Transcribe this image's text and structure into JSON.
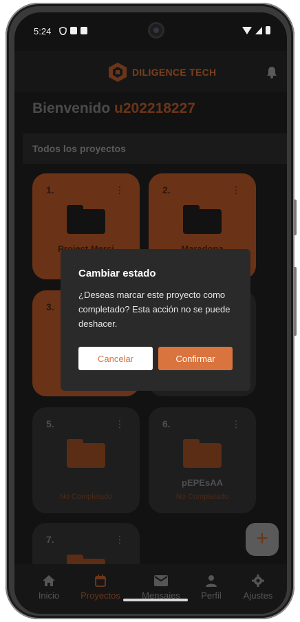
{
  "status_bar": {
    "time": "5:24"
  },
  "header": {
    "brand": "DILIGENCE TECH",
    "accent": "#d9743e"
  },
  "welcome": {
    "greeting": "Bienvenido",
    "username": "u202218227"
  },
  "section": {
    "title": "Todos los proyectos"
  },
  "projects": [
    {
      "num": "1.",
      "name": "Project Merci",
      "status": "",
      "color": "orange"
    },
    {
      "num": "2.",
      "name": "Maradona",
      "status": "",
      "color": "orange"
    },
    {
      "num": "3.",
      "name": "",
      "status": "",
      "color": "orange"
    },
    {
      "num": "",
      "name": "",
      "status": "",
      "color": "dark"
    },
    {
      "num": "5.",
      "name": "",
      "status": "No Completado",
      "color": "dark"
    },
    {
      "num": "6.",
      "name": "pEPEsAA",
      "status": "No Completado",
      "color": "dark"
    },
    {
      "num": "7.",
      "name": "",
      "status": "",
      "color": "dark"
    }
  ],
  "fab": {
    "label": "+"
  },
  "nav": [
    {
      "label": "Inicio",
      "icon": "home-icon"
    },
    {
      "label": "Proyectos",
      "icon": "calendar-icon",
      "active": true
    },
    {
      "label": "Mensajes",
      "icon": "mail-icon"
    },
    {
      "label": "Perfil",
      "icon": "person-icon"
    },
    {
      "label": "Ajustes",
      "icon": "gear-icon"
    }
  ],
  "dialog": {
    "title": "Cambiar estado",
    "body": "¿Deseas marcar este proyecto como completado? Esta acción no se puede deshacer.",
    "cancel": "Cancelar",
    "confirm": "Confirmar"
  }
}
